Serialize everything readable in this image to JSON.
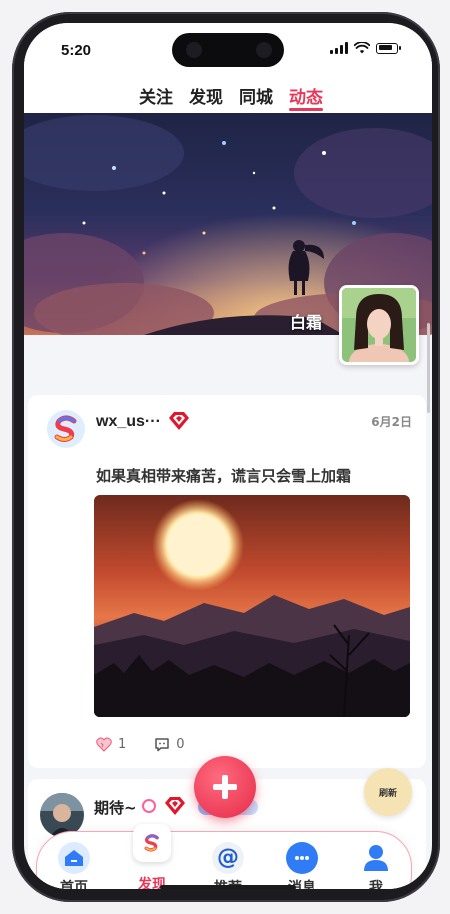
{
  "status_bar": {
    "time": "5:20"
  },
  "top_tabs": [
    {
      "label": "关注",
      "active": false
    },
    {
      "label": "发现",
      "active": false
    },
    {
      "label": "同城",
      "active": false
    },
    {
      "label": "动态",
      "active": true
    }
  ],
  "profile": {
    "name": "白霜"
  },
  "post": {
    "username": "wx_us···",
    "date": "6月2日",
    "text": "如果真相带来痛苦，谎言只会雪上加霜",
    "likes": "1",
    "comments": "0"
  },
  "next_post": {
    "username": "期待~"
  },
  "floating": {
    "refresh_label": "刷新",
    "add_icon": "plus-icon"
  },
  "bottom_nav": [
    {
      "label": "首页",
      "icon": "home-icon",
      "active": false
    },
    {
      "label": "发现",
      "icon": "discover-icon",
      "active": true
    },
    {
      "label": "推荐",
      "icon": "at-icon",
      "active": false
    },
    {
      "label": "消息",
      "icon": "message-icon",
      "active": false
    },
    {
      "label": "我",
      "icon": "person-icon",
      "active": false
    }
  ],
  "colors": {
    "accent": "#e8385a",
    "nav_blue": "#2f7cf6",
    "gem_red": "#e0162b"
  }
}
